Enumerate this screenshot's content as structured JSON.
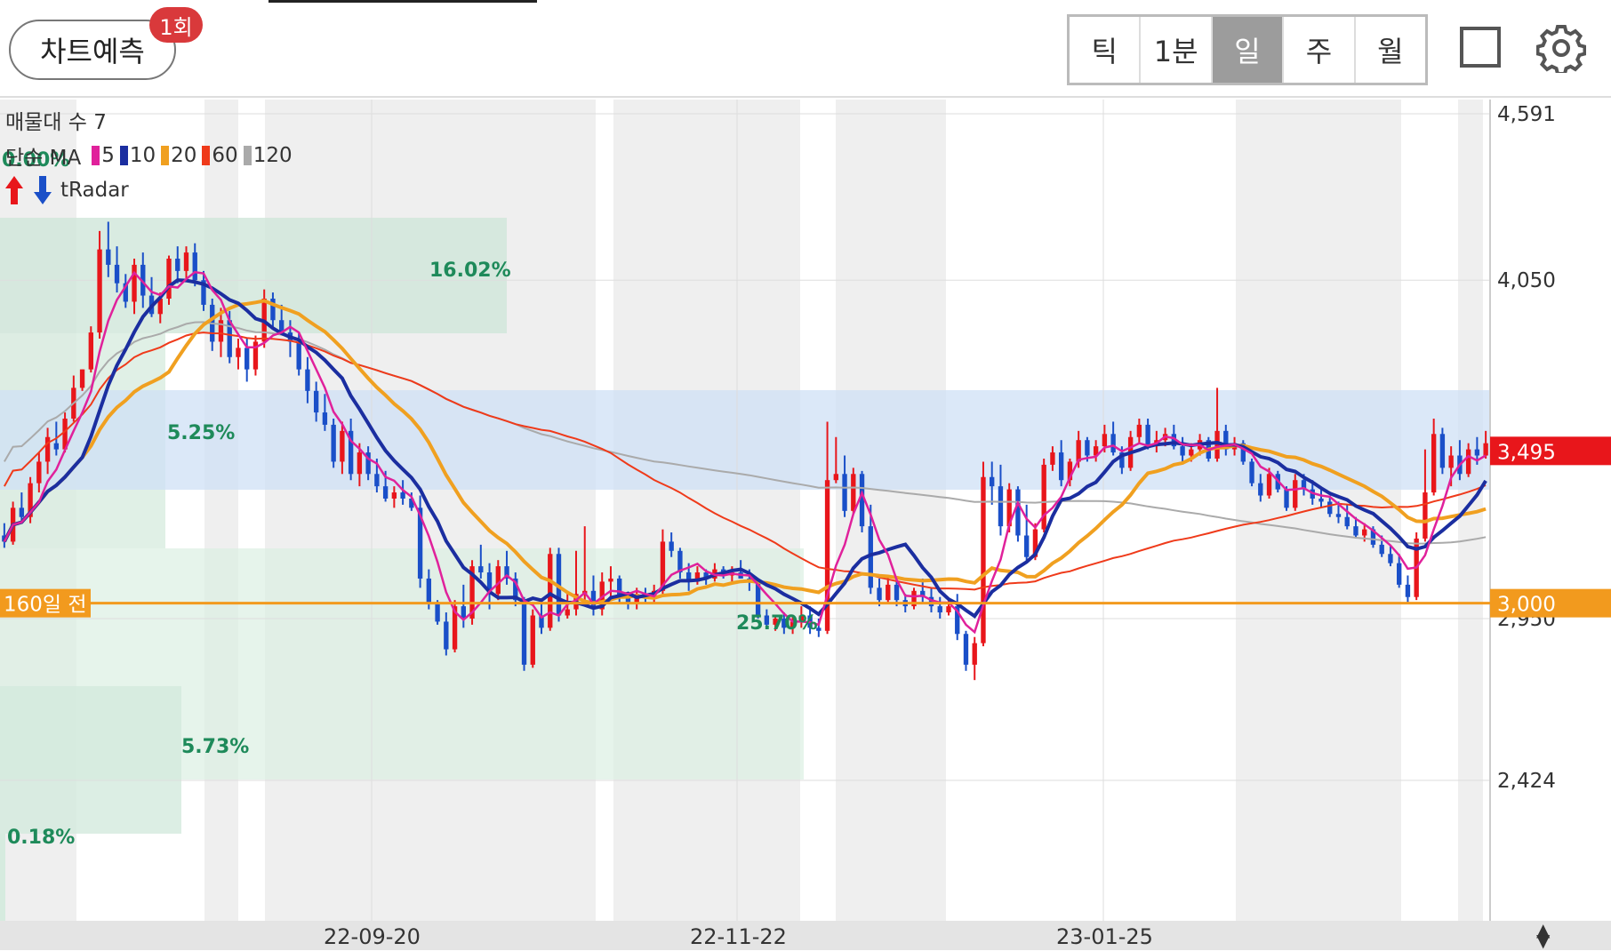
{
  "header": {
    "predict_label": "차트예측",
    "predict_badge": "1회",
    "periods": [
      {
        "label": "틱",
        "active": false
      },
      {
        "label": "1분",
        "active": false
      },
      {
        "label": "일",
        "active": true
      },
      {
        "label": "주",
        "active": false
      },
      {
        "label": "월",
        "active": false
      }
    ],
    "square_icon": "fullscreen-square-icon",
    "gear_icon": "gear-icon"
  },
  "indicators": {
    "volume_profile": "매물대 수 7",
    "ma_label": "단순 MA",
    "ma_periods": [
      {
        "label": "5",
        "color": "#e0219b"
      },
      {
        "label": "10",
        "color": "#1b2ea0"
      },
      {
        "label": "20",
        "color": "#f0a020"
      },
      {
        "label": "60",
        "color": "#ef3a1a"
      },
      {
        "label": "120",
        "color": "#aaaaaa"
      }
    ],
    "tradar_label": "tRadar"
  },
  "chart_data": {
    "type": "candlestick",
    "x_ticks": [
      "22-09-20",
      "22-11-22",
      "23-01-25"
    ],
    "y_ticks": [
      "4,591",
      "4,050",
      "2,950",
      "2,424"
    ],
    "current_price": "3,495",
    "reference_price": "3,000",
    "reference_label": "160일 전",
    "percent_labels": [
      "0.00%",
      "16.02%",
      "5.25%",
      "5.73%",
      "0.18%",
      "25.70%"
    ],
    "colors": {
      "up": "#e8161b",
      "down": "#1a4fc8",
      "current": "#e8161b",
      "reference": "#f29a1e"
    },
    "candles": [
      [
        3220,
        3260,
        3180,
        3200
      ],
      [
        3200,
        3330,
        3190,
        3310
      ],
      [
        3310,
        3360,
        3270,
        3280
      ],
      [
        3280,
        3410,
        3260,
        3390
      ],
      [
        3390,
        3490,
        3360,
        3460
      ],
      [
        3460,
        3570,
        3420,
        3540
      ],
      [
        3520,
        3590,
        3480,
        3500
      ],
      [
        3500,
        3620,
        3490,
        3600
      ],
      [
        3600,
        3740,
        3590,
        3700
      ],
      [
        3700,
        3760,
        3690,
        3760
      ],
      [
        3760,
        3900,
        3750,
        3880
      ],
      [
        3880,
        4210,
        3860,
        4150
      ],
      [
        4150,
        4240,
        4060,
        4100
      ],
      [
        4100,
        4160,
        4010,
        4040
      ],
      [
        4040,
        4070,
        3960,
        3980
      ],
      [
        3980,
        4120,
        3940,
        4100
      ],
      [
        4100,
        4140,
        3960,
        4000
      ],
      [
        4000,
        4060,
        3930,
        3940
      ],
      [
        3940,
        4010,
        3910,
        3990
      ],
      [
        3990,
        4130,
        3970,
        4120
      ],
      [
        4120,
        4160,
        4040,
        4080
      ],
      [
        4080,
        4160,
        4050,
        4140
      ],
      [
        4140,
        4170,
        4030,
        4050
      ],
      [
        4050,
        4080,
        3950,
        3970
      ],
      [
        3970,
        3990,
        3820,
        3850
      ],
      [
        3850,
        3960,
        3800,
        3920
      ],
      [
        3920,
        3950,
        3780,
        3800
      ],
      [
        3800,
        3860,
        3760,
        3830
      ],
      [
        3830,
        3860,
        3720,
        3760
      ],
      [
        3760,
        3870,
        3740,
        3850
      ],
      [
        3850,
        4020,
        3830,
        3990
      ],
      [
        3990,
        4010,
        3890,
        3920
      ],
      [
        3920,
        3970,
        3870,
        3880
      ],
      [
        3880,
        3920,
        3800,
        3850
      ],
      [
        3850,
        3880,
        3740,
        3760
      ],
      [
        3760,
        3800,
        3650,
        3690
      ],
      [
        3690,
        3720,
        3590,
        3620
      ],
      [
        3620,
        3680,
        3560,
        3580
      ],
      [
        3580,
        3600,
        3440,
        3460
      ],
      [
        3460,
        3590,
        3420,
        3560
      ],
      [
        3560,
        3600,
        3400,
        3420
      ],
      [
        3420,
        3520,
        3380,
        3490
      ],
      [
        3490,
        3510,
        3400,
        3420
      ],
      [
        3420,
        3470,
        3360,
        3380
      ],
      [
        3380,
        3430,
        3330,
        3340
      ],
      [
        3340,
        3380,
        3310,
        3360
      ],
      [
        3360,
        3400,
        3320,
        3340
      ],
      [
        3340,
        3360,
        3300,
        3310
      ],
      [
        3310,
        3350,
        3050,
        3080
      ],
      [
        3080,
        3110,
        2980,
        3000
      ],
      [
        3000,
        3010,
        2930,
        2940
      ],
      [
        2940,
        2970,
        2830,
        2850
      ],
      [
        2850,
        3010,
        2840,
        2990
      ],
      [
        2990,
        3060,
        2920,
        2950
      ],
      [
        2950,
        3140,
        2930,
        3120
      ],
      [
        3120,
        3190,
        3080,
        3100
      ],
      [
        3100,
        3130,
        2980,
        3030
      ],
      [
        3030,
        3140,
        3010,
        3120
      ],
      [
        3120,
        3170,
        3060,
        3080
      ],
      [
        3080,
        3100,
        2990,
        3010
      ],
      [
        3010,
        3020,
        2780,
        2800
      ],
      [
        2800,
        2980,
        2790,
        2960
      ],
      [
        2960,
        3000,
        2900,
        2920
      ],
      [
        2920,
        3180,
        2910,
        3160
      ],
      [
        3160,
        3180,
        2940,
        2960
      ],
      [
        2960,
        3040,
        2950,
        2980
      ],
      [
        2980,
        3170,
        2960,
        3030
      ],
      [
        3030,
        3250,
        3010,
        3040
      ],
      [
        3040,
        3090,
        2960,
        2980
      ],
      [
        2980,
        3100,
        2960,
        3070
      ],
      [
        3070,
        3120,
        3020,
        3080
      ],
      [
        3080,
        3090,
        3000,
        3020
      ],
      [
        3020,
        3030,
        2980,
        3000
      ],
      [
        3000,
        3050,
        2980,
        3030
      ],
      [
        3030,
        3050,
        3000,
        3020
      ],
      [
        3020,
        3060,
        3000,
        3040
      ],
      [
        3040,
        3240,
        3030,
        3200
      ],
      [
        3200,
        3230,
        3150,
        3170
      ],
      [
        3170,
        3180,
        3080,
        3100
      ],
      [
        3100,
        3130,
        3040,
        3070
      ],
      [
        3070,
        3120,
        3060,
        3100
      ],
      [
        3100,
        3110,
        3060,
        3080
      ],
      [
        3080,
        3130,
        3070,
        3110
      ],
      [
        3110,
        3120,
        3080,
        3090
      ],
      [
        3090,
        3120,
        3070,
        3100
      ],
      [
        3100,
        3140,
        3080,
        3080
      ],
      [
        3080,
        3110,
        3040,
        3070
      ],
      [
        3070,
        3080,
        2950,
        2960
      ],
      [
        2960,
        2980,
        2920,
        2930
      ],
      [
        2930,
        2960,
        2910,
        2950
      ],
      [
        2950,
        2970,
        2900,
        2920
      ],
      [
        2920,
        2960,
        2900,
        2940
      ],
      [
        2940,
        2990,
        2920,
        2960
      ],
      [
        2960,
        2990,
        2900,
        2920
      ],
      [
        2920,
        2950,
        2890,
        2910
      ],
      [
        2910,
        3590,
        2900,
        3400
      ],
      [
        3400,
        3540,
        3390,
        3420
      ],
      [
        3420,
        3480,
        3280,
        3300
      ],
      [
        3300,
        3440,
        3290,
        3420
      ],
      [
        3420,
        3430,
        3230,
        3250
      ],
      [
        3250,
        3320,
        3030,
        3050
      ],
      [
        3050,
        3080,
        2990,
        3010
      ],
      [
        3010,
        3090,
        3000,
        3060
      ],
      [
        3060,
        3080,
        2990,
        3010
      ],
      [
        3010,
        3030,
        2970,
        2990
      ],
      [
        2990,
        3050,
        2980,
        3040
      ],
      [
        3040,
        3080,
        3000,
        3020
      ],
      [
        3020,
        3050,
        2970,
        2990
      ],
      [
        2990,
        3020,
        2950,
        2970
      ],
      [
        2970,
        3010,
        2960,
        2990
      ],
      [
        2990,
        3030,
        2880,
        2900
      ],
      [
        2900,
        2910,
        2780,
        2800
      ],
      [
        2800,
        2890,
        2750,
        2870
      ],
      [
        2870,
        3460,
        2860,
        3410
      ],
      [
        3410,
        3460,
        3320,
        3380
      ],
      [
        3380,
        3450,
        3220,
        3250
      ],
      [
        3250,
        3390,
        3230,
        3370
      ],
      [
        3370,
        3380,
        3200,
        3220
      ],
      [
        3220,
        3320,
        3130,
        3150
      ],
      [
        3150,
        3260,
        3140,
        3240
      ],
      [
        3240,
        3470,
        3230,
        3450
      ],
      [
        3450,
        3510,
        3430,
        3490
      ],
      [
        3490,
        3530,
        3380,
        3400
      ],
      [
        3400,
        3470,
        3380,
        3460
      ],
      [
        3460,
        3560,
        3440,
        3530
      ],
      [
        3530,
        3540,
        3460,
        3480
      ],
      [
        3480,
        3530,
        3460,
        3510
      ],
      [
        3510,
        3580,
        3490,
        3550
      ],
      [
        3550,
        3590,
        3480,
        3490
      ],
      [
        3490,
        3510,
        3420,
        3440
      ],
      [
        3440,
        3560,
        3430,
        3540
      ],
      [
        3540,
        3600,
        3520,
        3580
      ],
      [
        3580,
        3600,
        3500,
        3510
      ],
      [
        3510,
        3560,
        3490,
        3530
      ],
      [
        3530,
        3570,
        3510,
        3550
      ],
      [
        3550,
        3580,
        3500,
        3510
      ],
      [
        3510,
        3540,
        3460,
        3480
      ],
      [
        3480,
        3520,
        3460,
        3500
      ],
      [
        3500,
        3550,
        3480,
        3530
      ],
      [
        3530,
        3540,
        3460,
        3470
      ],
      [
        3470,
        3700,
        3460,
        3560
      ],
      [
        3560,
        3580,
        3480,
        3500
      ],
      [
        3500,
        3540,
        3480,
        3520
      ],
      [
        3520,
        3530,
        3450,
        3460
      ],
      [
        3460,
        3470,
        3380,
        3390
      ],
      [
        3390,
        3420,
        3330,
        3350
      ],
      [
        3350,
        3440,
        3340,
        3420
      ],
      [
        3420,
        3430,
        3360,
        3370
      ],
      [
        3370,
        3380,
        3300,
        3310
      ],
      [
        3310,
        3420,
        3300,
        3400
      ],
      [
        3400,
        3420,
        3350,
        3370
      ],
      [
        3370,
        3400,
        3320,
        3340
      ],
      [
        3340,
        3370,
        3310,
        3330
      ],
      [
        3330,
        3350,
        3280,
        3290
      ],
      [
        3290,
        3330,
        3260,
        3280
      ],
      [
        3280,
        3320,
        3240,
        3250
      ],
      [
        3250,
        3280,
        3210,
        3220
      ],
      [
        3220,
        3260,
        3200,
        3240
      ],
      [
        3240,
        3250,
        3180,
        3190
      ],
      [
        3190,
        3220,
        3150,
        3160
      ],
      [
        3160,
        3190,
        3120,
        3130
      ],
      [
        3130,
        3160,
        3050,
        3060
      ],
      [
        3060,
        3090,
        3000,
        3020
      ],
      [
        3020,
        3230,
        3010,
        3210
      ],
      [
        3210,
        3500,
        3200,
        3360
      ],
      [
        3360,
        3600,
        3350,
        3550
      ],
      [
        3550,
        3570,
        3420,
        3440
      ],
      [
        3440,
        3510,
        3380,
        3480
      ],
      [
        3480,
        3530,
        3400,
        3420
      ],
      [
        3420,
        3520,
        3410,
        3500
      ],
      [
        3500,
        3540,
        3450,
        3480
      ],
      [
        3480,
        3560,
        3470,
        3520
      ]
    ]
  }
}
